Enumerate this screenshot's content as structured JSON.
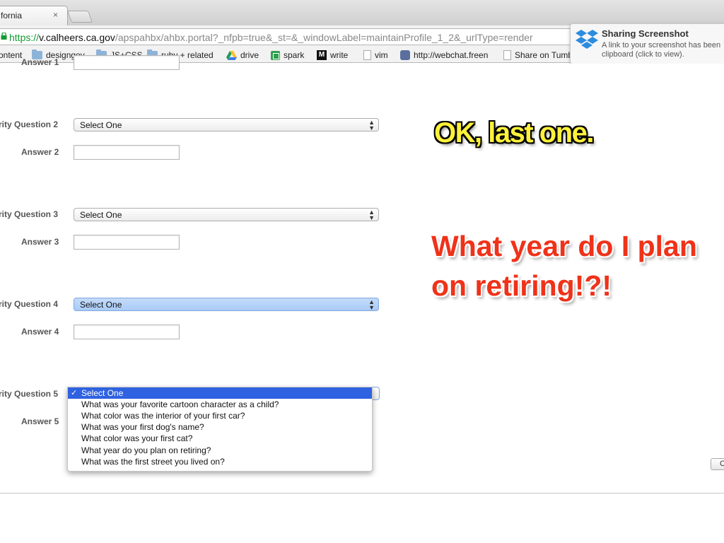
{
  "browser": {
    "tab_title": "fornia",
    "tab_close": "×",
    "url_scheme": "https://",
    "url_host": "v.calheers.ca.gov",
    "url_path": "/apspahbx/ahbx.portal?_nfpb=true&_st=&_windowLabel=maintainProfile_1_2&_urlType=render"
  },
  "bookmarks": [
    {
      "label": "ontent",
      "icon": "none"
    },
    {
      "label": "designgov",
      "icon": "folder-icon"
    },
    {
      "label": "JS+CSS",
      "icon": "folder-icon"
    },
    {
      "label": "ruby + related",
      "icon": "folder-icon"
    },
    {
      "label": "drive",
      "icon": "drive-icon"
    },
    {
      "label": "spark",
      "icon": "spreadsheet-icon"
    },
    {
      "label": "write",
      "icon": "m-icon"
    },
    {
      "label": "vim",
      "icon": "page-icon"
    },
    {
      "label": "http://webchat.freen",
      "icon": "web-icon"
    },
    {
      "label": "Share on Tumb",
      "icon": "page-icon"
    }
  ],
  "notification": {
    "title": "Sharing Screenshot",
    "line1": "A link to your screenshot has been",
    "line2": "clipboard (click to view)."
  },
  "form": {
    "answer1_label": "Answer 1",
    "q2_label": "rity Question 2",
    "q2_value": "Select One",
    "answer2_label": "Answer 2",
    "q3_label": "rity Question 3",
    "q3_value": "Select One",
    "answer3_label": "Answer 3",
    "q4_label": "rity Question 4",
    "q4_value": "Select One",
    "answer4_label": "Answer 4",
    "q5_label": "rity Question 5",
    "answer5_label": "Answer 5",
    "side_button": "C"
  },
  "dropdown": {
    "check": "✓",
    "options": [
      "Select One",
      "What was your favorite cartoon character as a child?",
      "What color was the interior of your first car?",
      "What was your first dog's name?",
      "What color was your first cat?",
      "What year do you plan on retiring?",
      "What was the first street you lived on?"
    ],
    "selected_index": 0
  },
  "annotations": {
    "yellow_text": "OK, last one.",
    "red_line1": "What year do I plan",
    "red_line2": "on retiring!?!"
  },
  "colors": {
    "url_scheme": "#159a32",
    "menu_selected": "#2f62e0",
    "annotation_yellow": "#fff13a",
    "annotation_red": "#ef3219"
  }
}
